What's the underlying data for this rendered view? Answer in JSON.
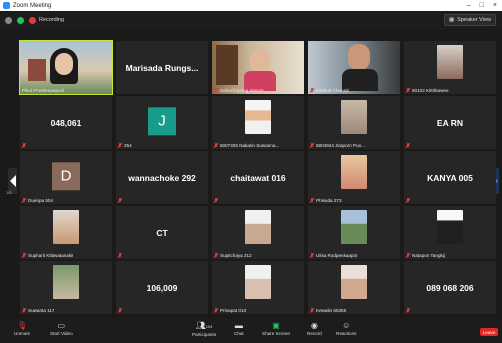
{
  "window": {
    "title": "Zoom Meeting",
    "recording_label": "Recording",
    "view_label": "Speaker View"
  },
  "tiles": [
    {
      "id": "t1",
      "name": "Pikul Phetdeepapool",
      "big": "",
      "active": true,
      "kind": "video"
    },
    {
      "id": "t2",
      "name": "",
      "big": "Marisada Rungs...",
      "kind": "name"
    },
    {
      "id": "t3",
      "name": "Sahachopong Aksorn",
      "big": "",
      "kind": "video"
    },
    {
      "id": "t4",
      "name": "Kittithat Chansiri",
      "big": "",
      "kind": "video"
    },
    {
      "id": "t5",
      "name": "60102 Kittithawee",
      "big": "",
      "kind": "photo"
    },
    {
      "id": "t6",
      "name": "",
      "big": "048,061",
      "kind": "name"
    },
    {
      "id": "t7",
      "name": "254",
      "big": "",
      "kind": "letter",
      "letter": "J"
    },
    {
      "id": "t8",
      "name": "6007406 Nakarin Suwanna...",
      "big": "",
      "kind": "photo"
    },
    {
      "id": "t9",
      "name": "5804944 Jiraporn Puo...",
      "big": "",
      "kind": "photo"
    },
    {
      "id": "t10",
      "name": "",
      "big": "EA RN",
      "kind": "name"
    },
    {
      "id": "t11",
      "name": "Duenpa 504",
      "big": "",
      "kind": "letter",
      "letter": "D"
    },
    {
      "id": "t12",
      "name": "",
      "big": "wannachoke 292",
      "kind": "name"
    },
    {
      "id": "t13",
      "name": "",
      "big": "chaitawat 016",
      "kind": "name"
    },
    {
      "id": "t14",
      "name": "Phisuda 273",
      "big": "",
      "kind": "photo"
    },
    {
      "id": "t15",
      "name": "",
      "big": "KANYA 005",
      "kind": "name"
    },
    {
      "id": "t16",
      "name": "Supharit Kittiwatanakit",
      "big": "",
      "kind": "photo"
    },
    {
      "id": "t17",
      "name": "",
      "big": "CT",
      "kind": "name"
    },
    {
      "id": "t18",
      "name": "Supitchaya 212",
      "big": "",
      "kind": "photo"
    },
    {
      "id": "t19",
      "name": "Ulisa Rodpenkaapot",
      "big": "",
      "kind": "photo"
    },
    {
      "id": "t20",
      "name": "Natapon Tangkij",
      "big": "",
      "kind": "photo"
    },
    {
      "id": "t21",
      "name": "Suwanta 117",
      "big": "",
      "kind": "photo"
    },
    {
      "id": "t22",
      "name": "",
      "big": "106,009",
      "kind": "name"
    },
    {
      "id": "t23",
      "name": "Prinapat 013",
      "big": "",
      "kind": "photo"
    },
    {
      "id": "t24",
      "name": "Kewalin 60255",
      "big": "",
      "kind": "photo"
    },
    {
      "id": "t25",
      "name": "",
      "big": "089 068 206",
      "kind": "name"
    }
  ],
  "pager": {
    "left_num": "1/5",
    "right_num": "1/5"
  },
  "toolbar": {
    "unmute": "Unmute",
    "start_video": "Start Video",
    "participants": "Participants",
    "participants_count": "104",
    "chat": "Chat",
    "share_screen": "Share Screen",
    "record": "Record",
    "reactions": "Reactions",
    "leave": "Leave"
  },
  "colors": {
    "accent": "#2d8cff",
    "share": "#22c55e",
    "leave": "#e02828",
    "active_outline": "#c9e52a"
  }
}
